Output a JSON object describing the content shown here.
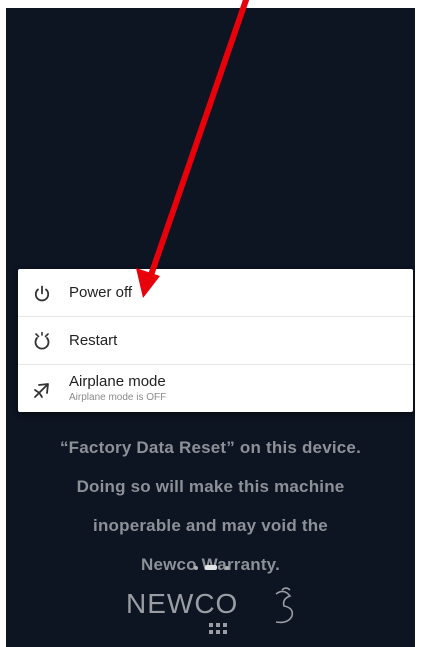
{
  "power_menu": {
    "items": [
      {
        "label": "Power off",
        "icon": "power-icon"
      },
      {
        "label": "Restart",
        "icon": "restart-icon"
      },
      {
        "label": "Airplane mode",
        "sublabel": "Airplane mode is OFF",
        "icon": "airplane-icon"
      }
    ]
  },
  "wallpaper": {
    "lines": [
      "“Factory Data Reset” on this device.",
      "Doing so will make this machine",
      "inoperable and may void the",
      "Newco Warranty."
    ],
    "logo_text": "NEWCO"
  },
  "annotation": {
    "arrow_color": "#e8000b"
  },
  "colors": {
    "screen_background": "#0d1422",
    "dialog_background": "#ffffff"
  }
}
